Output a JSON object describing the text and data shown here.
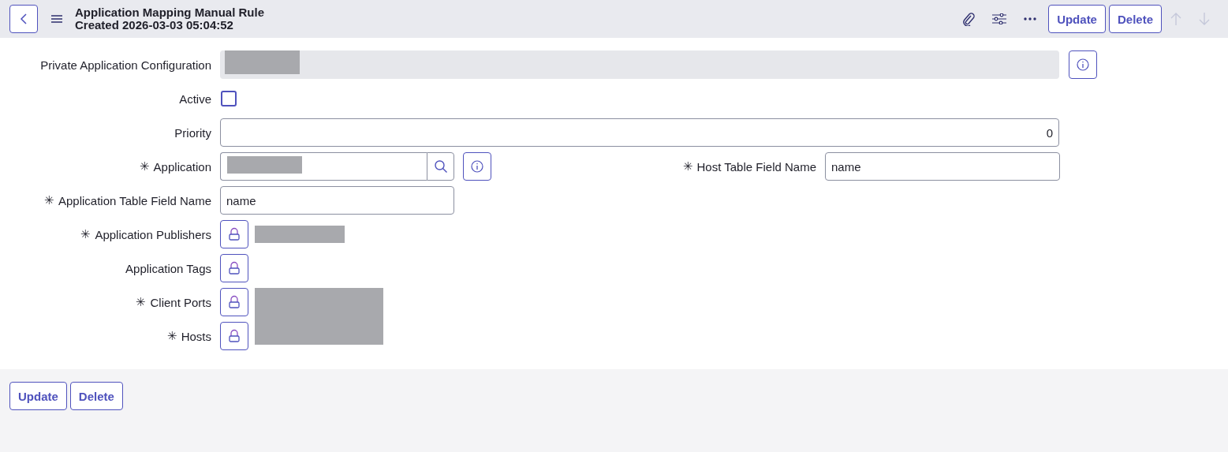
{
  "header": {
    "title": "Application Mapping Manual Rule",
    "subtitle": "Created 2026-03-03 05:04:52",
    "buttons": [
      "Update",
      "Delete"
    ],
    "nav": [
      {
        "kind": "up",
        "disabled": true
      },
      {
        "kind": "down",
        "disabled": true
      }
    ]
  },
  "fields": [
    {
      "kind": "readonly",
      "label": "Private Application Configuration",
      "redacted": true
    },
    {
      "kind": "checkbox",
      "label": "Active",
      "checked": false
    },
    {
      "kind": "number",
      "label": "Priority",
      "value": "0"
    },
    {
      "kind": "reference",
      "label": "Application",
      "required_mark": "✳",
      "redacted": true,
      "side": {
        "label": "Host Table Field Name",
        "required_mark": "✳",
        "value": "name"
      }
    },
    {
      "kind": "text",
      "label": "Application Table Field Name",
      "required_mark": "✳",
      "value": "name"
    },
    {
      "kind": "locked",
      "label": "Application Publishers",
      "required_mark": "✳",
      "redacted": true,
      "tall": false
    },
    {
      "kind": "locked",
      "label": "Application Tags"
    },
    {
      "kind": "locked",
      "label": "Client Ports",
      "required_mark": "✳",
      "redacted": true,
      "tall": true
    },
    {
      "kind": "locked",
      "label": "Hosts",
      "required_mark": "✳"
    }
  ],
  "footer": {
    "buttons": [
      "Update",
      "Delete"
    ]
  }
}
